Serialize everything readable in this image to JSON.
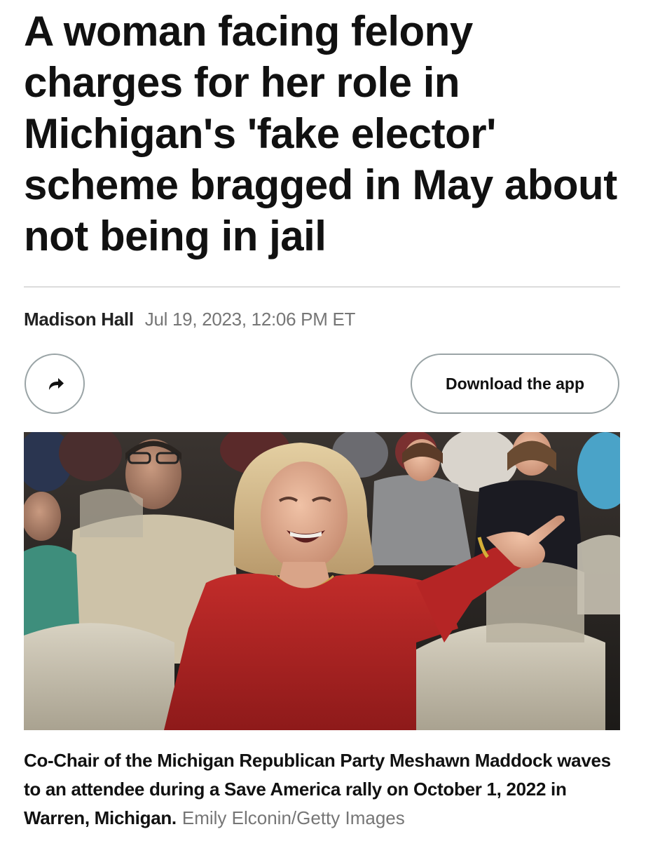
{
  "article": {
    "headline": "A woman facing felony charges for her role in Michigan's 'fake elector' scheme bragged in May about not being in jail",
    "author": "Madison Hall",
    "date": "Jul 19, 2023, 12:06 PM ET"
  },
  "actions": {
    "share_icon": "share-arrow-icon",
    "download_label": "Download the app"
  },
  "photo": {
    "caption": "Co-Chair of the Michigan Republican Party Meshawn Maddock waves to an attendee during a Save America rally on October 1, 2022 in Warren, Michigan.",
    "credit": "Emily Elconin/Getty Images"
  },
  "colors": {
    "text": "#111111",
    "muted": "#767676",
    "button_border": "#9aa4a6",
    "divider": "#dcdcdc"
  }
}
